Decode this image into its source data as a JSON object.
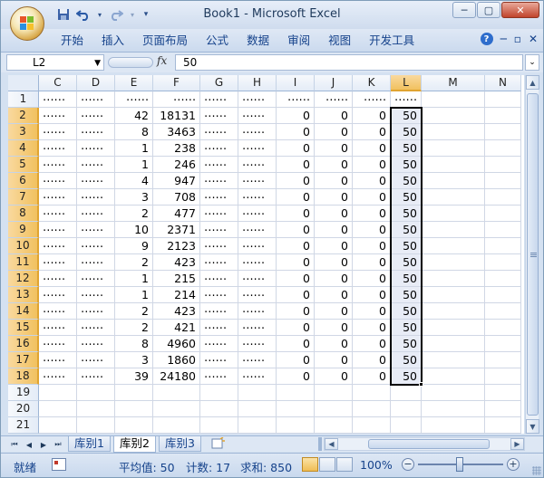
{
  "title_bar": {
    "title": "Book1 - Microsoft Excel",
    "minimize": "─",
    "restore": "▢",
    "close": "✕"
  },
  "quick_access": {
    "save_icon": "save-icon",
    "undo_icon": "undo-icon",
    "redo_icon": "redo-icon",
    "customize_icon": "chevron-down-icon"
  },
  "ribbon": {
    "tabs": [
      {
        "label": "开始"
      },
      {
        "label": "插入"
      },
      {
        "label": "页面布局"
      },
      {
        "label": "公式"
      },
      {
        "label": "数据"
      },
      {
        "label": "审阅"
      },
      {
        "label": "视图"
      },
      {
        "label": "开发工具"
      }
    ],
    "help": "?",
    "minimize": "─",
    "restore": "▫",
    "close": "✕"
  },
  "formula_bar": {
    "name_box": "L2",
    "fx_label": "fx",
    "value": "50"
  },
  "columns": [
    "C",
    "D",
    "E",
    "F",
    "G",
    "H",
    "I",
    "J",
    "K",
    "L",
    "M",
    "N"
  ],
  "rows": [
    {
      "num": "1",
      "C": "⋯⋯",
      "D": "⋯⋯",
      "E": "⋯⋯",
      "F": "⋯⋯",
      "G": "⋯⋯",
      "H": "⋯⋯",
      "I": "⋯⋯",
      "J": "⋯⋯",
      "K": "⋯⋯",
      "L": "⋯⋯"
    },
    {
      "num": "2",
      "C": "⋯⋯",
      "D": "⋯⋯",
      "E": "42",
      "F": "18131",
      "G": "⋯⋯",
      "H": "⋯⋯",
      "I": "0",
      "J": "0",
      "K": "0",
      "L": "50"
    },
    {
      "num": "3",
      "C": "⋯⋯",
      "D": "⋯⋯",
      "E": "8",
      "F": "3463",
      "G": "⋯⋯",
      "H": "⋯⋯",
      "I": "0",
      "J": "0",
      "K": "0",
      "L": "50"
    },
    {
      "num": "4",
      "C": "⋯⋯",
      "D": "⋯⋯",
      "E": "1",
      "F": "238",
      "G": "⋯⋯",
      "H": "⋯⋯",
      "I": "0",
      "J": "0",
      "K": "0",
      "L": "50"
    },
    {
      "num": "5",
      "C": "⋯⋯",
      "D": "⋯⋯",
      "E": "1",
      "F": "246",
      "G": "⋯⋯",
      "H": "⋯⋯",
      "I": "0",
      "J": "0",
      "K": "0",
      "L": "50"
    },
    {
      "num": "6",
      "C": "⋯⋯",
      "D": "⋯⋯",
      "E": "4",
      "F": "947",
      "G": "⋯⋯",
      "H": "⋯⋯",
      "I": "0",
      "J": "0",
      "K": "0",
      "L": "50"
    },
    {
      "num": "7",
      "C": "⋯⋯",
      "D": "⋯⋯",
      "E": "3",
      "F": "708",
      "G": "⋯⋯",
      "H": "⋯⋯",
      "I": "0",
      "J": "0",
      "K": "0",
      "L": "50"
    },
    {
      "num": "8",
      "C": "⋯⋯",
      "D": "⋯⋯",
      "E": "2",
      "F": "477",
      "G": "⋯⋯",
      "H": "⋯⋯",
      "I": "0",
      "J": "0",
      "K": "0",
      "L": "50"
    },
    {
      "num": "9",
      "C": "⋯⋯",
      "D": "⋯⋯",
      "E": "10",
      "F": "2371",
      "G": "⋯⋯",
      "H": "⋯⋯",
      "I": "0",
      "J": "0",
      "K": "0",
      "L": "50"
    },
    {
      "num": "10",
      "C": "⋯⋯",
      "D": "⋯⋯",
      "E": "9",
      "F": "2123",
      "G": "⋯⋯",
      "H": "⋯⋯",
      "I": "0",
      "J": "0",
      "K": "0",
      "L": "50"
    },
    {
      "num": "11",
      "C": "⋯⋯",
      "D": "⋯⋯",
      "E": "2",
      "F": "423",
      "G": "⋯⋯",
      "H": "⋯⋯",
      "I": "0",
      "J": "0",
      "K": "0",
      "L": "50"
    },
    {
      "num": "12",
      "C": "⋯⋯",
      "D": "⋯⋯",
      "E": "1",
      "F": "215",
      "G": "⋯⋯",
      "H": "⋯⋯",
      "I": "0",
      "J": "0",
      "K": "0",
      "L": "50"
    },
    {
      "num": "13",
      "C": "⋯⋯",
      "D": "⋯⋯",
      "E": "1",
      "F": "214",
      "G": "⋯⋯",
      "H": "⋯⋯",
      "I": "0",
      "J": "0",
      "K": "0",
      "L": "50"
    },
    {
      "num": "14",
      "C": "⋯⋯",
      "D": "⋯⋯",
      "E": "2",
      "F": "423",
      "G": "⋯⋯",
      "H": "⋯⋯",
      "I": "0",
      "J": "0",
      "K": "0",
      "L": "50"
    },
    {
      "num": "15",
      "C": "⋯⋯",
      "D": "⋯⋯",
      "E": "2",
      "F": "421",
      "G": "⋯⋯",
      "H": "⋯⋯",
      "I": "0",
      "J": "0",
      "K": "0",
      "L": "50"
    },
    {
      "num": "16",
      "C": "⋯⋯",
      "D": "⋯⋯",
      "E": "8",
      "F": "4960",
      "G": "⋯⋯",
      "H": "⋯⋯",
      "I": "0",
      "J": "0",
      "K": "0",
      "L": "50"
    },
    {
      "num": "17",
      "C": "⋯⋯",
      "D": "⋯⋯",
      "E": "3",
      "F": "1860",
      "G": "⋯⋯",
      "H": "⋯⋯",
      "I": "0",
      "J": "0",
      "K": "0",
      "L": "50"
    },
    {
      "num": "18",
      "C": "⋯⋯",
      "D": "⋯⋯",
      "E": "39",
      "F": "24180",
      "G": "⋯⋯",
      "H": "⋯⋯",
      "I": "0",
      "J": "0",
      "K": "0",
      "L": "50"
    },
    {
      "num": "19"
    },
    {
      "num": "20"
    },
    {
      "num": "21"
    }
  ],
  "selection": {
    "cell": "L2",
    "range": "L2:L18"
  },
  "sheet_tabs": [
    {
      "label": "库别1"
    },
    {
      "label": "库别2",
      "active": true
    },
    {
      "label": "库别3"
    }
  ],
  "status_bar": {
    "ready": "就绪",
    "average": "平均值: 50",
    "count": "计数: 17",
    "sum": "求和: 850",
    "zoom": "100%",
    "zoom_minus": "−",
    "zoom_plus": "+"
  },
  "colors": {
    "accent": "#15428b",
    "selected_header": "#f1c15f",
    "selection_fill": "#e8ecf6"
  }
}
